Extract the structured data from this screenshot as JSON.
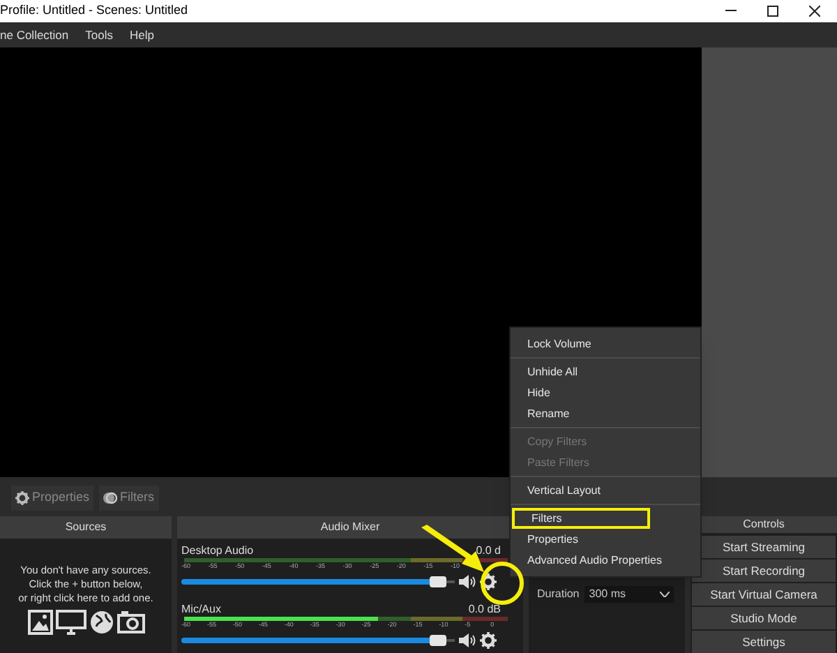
{
  "window": {
    "title": "Profile: Untitled - Scenes: Untitled"
  },
  "menu_bar": [
    "ne Collection",
    "Tools",
    "Help"
  ],
  "toolbar": [
    {
      "label": "Properties"
    },
    {
      "label": "Filters"
    }
  ],
  "sources": {
    "title": "Sources",
    "empty_message": "You don't have any sources.\nClick the + button below,\nor right click here to add one."
  },
  "audio_mixer": {
    "title": "Audio Mixer",
    "channels": [
      {
        "name": "Desktop Audio",
        "reading": "0.0 d",
        "level": 0,
        "volume": {
          "level": 0.97
        },
        "ticks": [
          "-60",
          "-55",
          "-50",
          "-45",
          "-40",
          "-35",
          "-30",
          "-25",
          "-20",
          "-15",
          "-10"
        ]
      },
      {
        "name": "Mic/Aux",
        "reading": "0.0 dB",
        "level": 0.6,
        "volume": {
          "level": 0.97
        },
        "ticks": [
          "-60",
          "-55",
          "-50",
          "-45",
          "-40",
          "-35",
          "-30",
          "-25",
          "-20",
          "-15",
          "-10",
          "-5",
          "0"
        ]
      }
    ]
  },
  "transitions": {
    "duration_label": "Duration",
    "duration_value": "300 ms"
  },
  "controls": {
    "title": "Controls",
    "buttons": [
      "Start Streaming",
      "Start Recording",
      "Start Virtual Camera",
      "Studio Mode",
      "Settings"
    ]
  },
  "context_menu": [
    {
      "kind": "item",
      "label": "Lock Volume",
      "disabled": false
    },
    {
      "kind": "separator"
    },
    {
      "kind": "item",
      "label": "Unhide All",
      "disabled": false
    },
    {
      "kind": "item",
      "label": "Hide",
      "disabled": false
    },
    {
      "kind": "item",
      "label": "Rename",
      "disabled": false
    },
    {
      "kind": "separator"
    },
    {
      "kind": "item",
      "label": "Copy Filters",
      "disabled": true
    },
    {
      "kind": "item",
      "label": "Paste Filters",
      "disabled": true
    },
    {
      "kind": "separator"
    },
    {
      "kind": "item",
      "label": "Vertical Layout",
      "disabled": false
    },
    {
      "kind": "separator"
    },
    {
      "kind": "item",
      "label": "Filters",
      "disabled": false,
      "highlighted": true
    },
    {
      "kind": "item",
      "label": "Properties",
      "disabled": false
    },
    {
      "kind": "item",
      "label": "Advanced Audio Properties",
      "disabled": false
    }
  ]
}
